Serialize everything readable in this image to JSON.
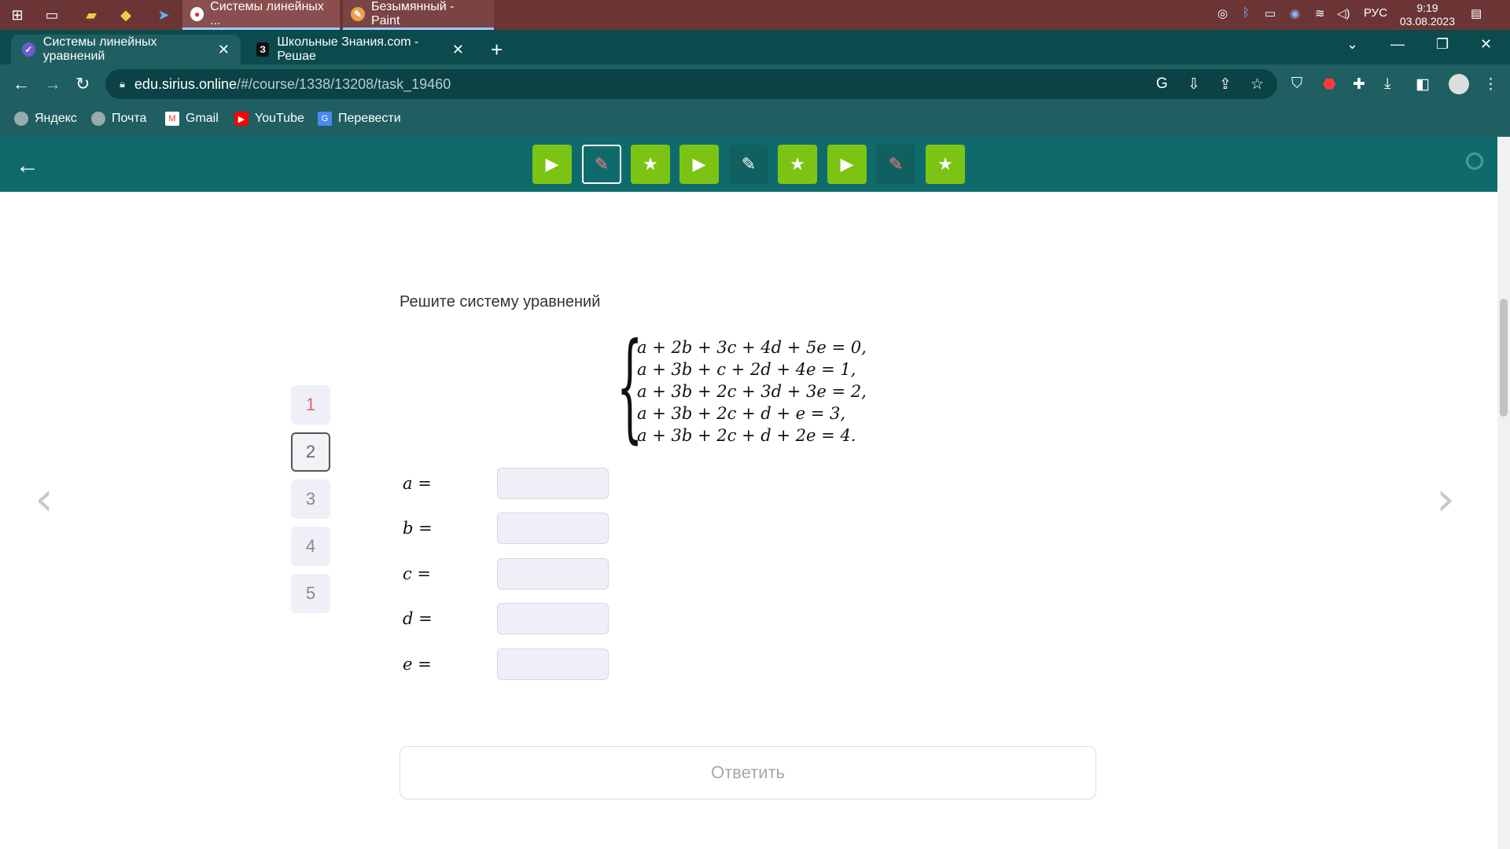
{
  "taskbar": {
    "apps": [
      {
        "label": "Системы линейных ..."
      },
      {
        "label": "Безымянный - Paint"
      }
    ],
    "tray": {
      "lang": "РУС",
      "time": "9:19",
      "date": "03.08.2023"
    }
  },
  "browser": {
    "tabs": [
      {
        "label": "Системы линейных уравнений"
      },
      {
        "label": "Школьные Знания.com - Решае"
      }
    ],
    "url_host": "edu.sirius.online",
    "url_path": "/#/course/1338/13208/task_19460",
    "bookmarks": [
      {
        "label": "Яндекс"
      },
      {
        "label": "Почта"
      },
      {
        "label": "Gmail"
      },
      {
        "label": "YouTube"
      },
      {
        "label": "Перевести"
      }
    ]
  },
  "task": {
    "title": "Решите систему уравнений",
    "equations": [
      "a + 2b + 3c + 4d + 5e = 0,",
      "a + 3b + c + 2d + 4e = 1,",
      "a + 3b + 2c + 3d + 3e = 2,",
      "a + 3b + 2c + d + e = 3,",
      "a + 3b + 2c + d + 2e = 4."
    ],
    "variables": [
      {
        "label": "a =",
        "value": ""
      },
      {
        "label": "b =",
        "value": ""
      },
      {
        "label": "c =",
        "value": ""
      },
      {
        "label": "d =",
        "value": ""
      },
      {
        "label": "e =",
        "value": ""
      }
    ],
    "question_numbers": [
      "1",
      "2",
      "3",
      "4",
      "5"
    ],
    "answer_label": "Ответить"
  },
  "colors": {
    "header_teal": "#0f6b6b",
    "step_green": "#7cc414",
    "incorrect_pink": "#e0636b"
  }
}
